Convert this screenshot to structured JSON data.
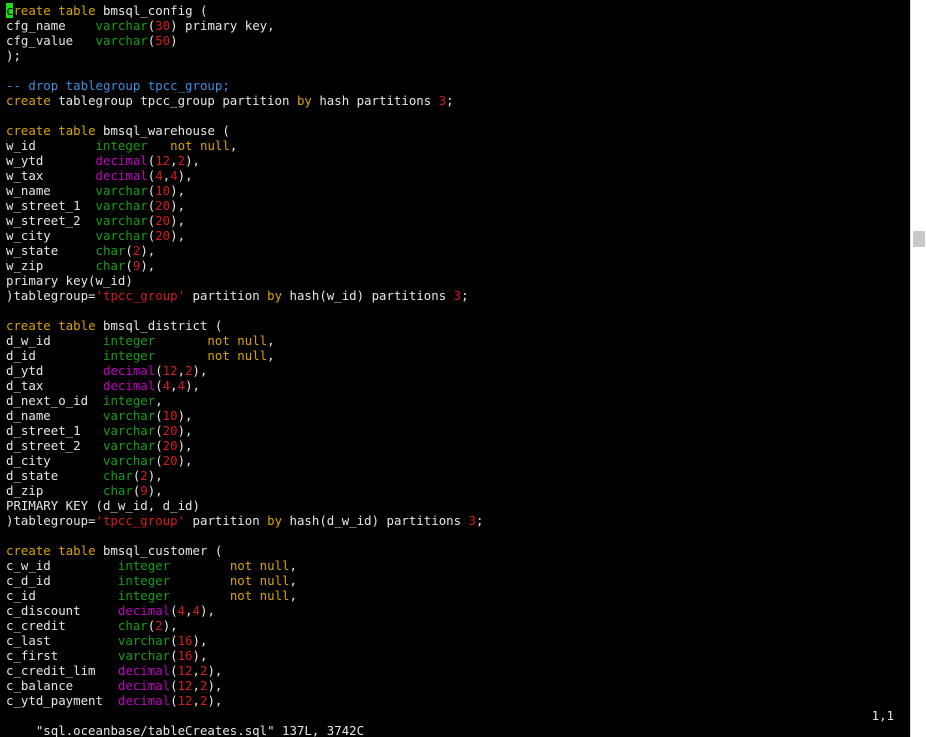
{
  "app": {
    "name": "vim",
    "colors": {
      "background": "#000000",
      "text": "#e6e6e6",
      "keyword": "#d9a300",
      "type": "#159e15",
      "number": "#d61b1b",
      "function": "#c000c0",
      "comment": "#3a8fe0",
      "cursor": "#15e015"
    }
  },
  "editor": {
    "lines": [
      [
        [
          "kw",
          "create"
        ],
        [
          "t",
          " "
        ],
        [
          "kw",
          "table"
        ],
        [
          "t",
          " bmsql_config ("
        ]
      ],
      [
        [
          "t",
          "cfg_name    "
        ],
        [
          "type",
          "varchar"
        ],
        [
          "t",
          "("
        ],
        [
          "num",
          "30"
        ],
        [
          "t",
          ") primary key,"
        ]
      ],
      [
        [
          "t",
          "cfg_value   "
        ],
        [
          "type",
          "varchar"
        ],
        [
          "t",
          "("
        ],
        [
          "num",
          "50"
        ],
        [
          "t",
          ")"
        ]
      ],
      [
        [
          "t",
          ");"
        ]
      ],
      [],
      [
        [
          "comment",
          "-- drop tablegroup tpcc_group;"
        ]
      ],
      [
        [
          "kw",
          "create"
        ],
        [
          "t",
          " tablegroup tpcc_group partition "
        ],
        [
          "kw",
          "by"
        ],
        [
          "t",
          " hash partitions "
        ],
        [
          "num",
          "3"
        ],
        [
          "t",
          ";"
        ]
      ],
      [],
      [
        [
          "kw",
          "create"
        ],
        [
          "t",
          " "
        ],
        [
          "kw",
          "table"
        ],
        [
          "t",
          " bmsql_warehouse ("
        ]
      ],
      [
        [
          "t",
          "w_id        "
        ],
        [
          "type",
          "integer"
        ],
        [
          "t",
          "   "
        ],
        [
          "null",
          "not"
        ],
        [
          "t",
          " "
        ],
        [
          "null",
          "null"
        ],
        [
          "t",
          ","
        ]
      ],
      [
        [
          "t",
          "w_ytd       "
        ],
        [
          "fn",
          "decimal"
        ],
        [
          "t",
          "("
        ],
        [
          "num",
          "12"
        ],
        [
          "t",
          ","
        ],
        [
          "num",
          "2"
        ],
        [
          "t",
          "),"
        ]
      ],
      [
        [
          "t",
          "w_tax       "
        ],
        [
          "fn",
          "decimal"
        ],
        [
          "t",
          "("
        ],
        [
          "num",
          "4"
        ],
        [
          "t",
          ","
        ],
        [
          "num",
          "4"
        ],
        [
          "t",
          "),"
        ]
      ],
      [
        [
          "t",
          "w_name      "
        ],
        [
          "type",
          "varchar"
        ],
        [
          "t",
          "("
        ],
        [
          "num",
          "10"
        ],
        [
          "t",
          "),"
        ]
      ],
      [
        [
          "t",
          "w_street_1  "
        ],
        [
          "type",
          "varchar"
        ],
        [
          "t",
          "("
        ],
        [
          "num",
          "20"
        ],
        [
          "t",
          "),"
        ]
      ],
      [
        [
          "t",
          "w_street_2  "
        ],
        [
          "type",
          "varchar"
        ],
        [
          "t",
          "("
        ],
        [
          "num",
          "20"
        ],
        [
          "t",
          "),"
        ]
      ],
      [
        [
          "t",
          "w_city      "
        ],
        [
          "type",
          "varchar"
        ],
        [
          "t",
          "("
        ],
        [
          "num",
          "20"
        ],
        [
          "t",
          "),"
        ]
      ],
      [
        [
          "t",
          "w_state     "
        ],
        [
          "type",
          "char"
        ],
        [
          "t",
          "("
        ],
        [
          "num",
          "2"
        ],
        [
          "t",
          "),"
        ]
      ],
      [
        [
          "t",
          "w_zip       "
        ],
        [
          "type",
          "char"
        ],
        [
          "t",
          "("
        ],
        [
          "num",
          "9"
        ],
        [
          "t",
          "),"
        ]
      ],
      [
        [
          "t",
          "primary key(w_id)"
        ]
      ],
      [
        [
          "t",
          ")tablegroup="
        ],
        [
          "str",
          "'tpcc_group'"
        ],
        [
          "t",
          " partition "
        ],
        [
          "kw",
          "by"
        ],
        [
          "t",
          " hash(w_id) partitions "
        ],
        [
          "num",
          "3"
        ],
        [
          "t",
          ";"
        ]
      ],
      [],
      [
        [
          "kw",
          "create"
        ],
        [
          "t",
          " "
        ],
        [
          "kw",
          "table"
        ],
        [
          "t",
          " bmsql_district ("
        ]
      ],
      [
        [
          "t",
          "d_w_id       "
        ],
        [
          "type",
          "integer"
        ],
        [
          "t",
          "       "
        ],
        [
          "null",
          "not"
        ],
        [
          "t",
          " "
        ],
        [
          "null",
          "null"
        ],
        [
          "t",
          ","
        ]
      ],
      [
        [
          "t",
          "d_id         "
        ],
        [
          "type",
          "integer"
        ],
        [
          "t",
          "       "
        ],
        [
          "null",
          "not"
        ],
        [
          "t",
          " "
        ],
        [
          "null",
          "null"
        ],
        [
          "t",
          ","
        ]
      ],
      [
        [
          "t",
          "d_ytd        "
        ],
        [
          "fn",
          "decimal"
        ],
        [
          "t",
          "("
        ],
        [
          "num",
          "12"
        ],
        [
          "t",
          ","
        ],
        [
          "num",
          "2"
        ],
        [
          "t",
          "),"
        ]
      ],
      [
        [
          "t",
          "d_tax        "
        ],
        [
          "fn",
          "decimal"
        ],
        [
          "t",
          "("
        ],
        [
          "num",
          "4"
        ],
        [
          "t",
          ","
        ],
        [
          "num",
          "4"
        ],
        [
          "t",
          "),"
        ]
      ],
      [
        [
          "t",
          "d_next_o_id  "
        ],
        [
          "type",
          "integer"
        ],
        [
          "t",
          ","
        ]
      ],
      [
        [
          "t",
          "d_name       "
        ],
        [
          "type",
          "varchar"
        ],
        [
          "t",
          "("
        ],
        [
          "num",
          "10"
        ],
        [
          "t",
          "),"
        ]
      ],
      [
        [
          "t",
          "d_street_1   "
        ],
        [
          "type",
          "varchar"
        ],
        [
          "t",
          "("
        ],
        [
          "num",
          "20"
        ],
        [
          "t",
          "),"
        ]
      ],
      [
        [
          "t",
          "d_street_2   "
        ],
        [
          "type",
          "varchar"
        ],
        [
          "t",
          "("
        ],
        [
          "num",
          "20"
        ],
        [
          "t",
          "),"
        ]
      ],
      [
        [
          "t",
          "d_city       "
        ],
        [
          "type",
          "varchar"
        ],
        [
          "t",
          "("
        ],
        [
          "num",
          "20"
        ],
        [
          "t",
          "),"
        ]
      ],
      [
        [
          "t",
          "d_state      "
        ],
        [
          "type",
          "char"
        ],
        [
          "t",
          "("
        ],
        [
          "num",
          "2"
        ],
        [
          "t",
          "),"
        ]
      ],
      [
        [
          "t",
          "d_zip        "
        ],
        [
          "type",
          "char"
        ],
        [
          "t",
          "("
        ],
        [
          "num",
          "9"
        ],
        [
          "t",
          "),"
        ]
      ],
      [
        [
          "t",
          "PRIMARY KEY (d_w_id, d_id)"
        ]
      ],
      [
        [
          "t",
          ")tablegroup="
        ],
        [
          "str",
          "'tpcc_group'"
        ],
        [
          "t",
          " partition "
        ],
        [
          "kw",
          "by"
        ],
        [
          "t",
          " hash(d_w_id) partitions "
        ],
        [
          "num",
          "3"
        ],
        [
          "t",
          ";"
        ]
      ],
      [],
      [
        [
          "kw",
          "create"
        ],
        [
          "t",
          " "
        ],
        [
          "kw",
          "table"
        ],
        [
          "t",
          " bmsql_customer ("
        ]
      ],
      [
        [
          "t",
          "c_w_id         "
        ],
        [
          "type",
          "integer"
        ],
        [
          "t",
          "        "
        ],
        [
          "null",
          "not"
        ],
        [
          "t",
          " "
        ],
        [
          "null",
          "null"
        ],
        [
          "t",
          ","
        ]
      ],
      [
        [
          "t",
          "c_d_id         "
        ],
        [
          "type",
          "integer"
        ],
        [
          "t",
          "        "
        ],
        [
          "null",
          "not"
        ],
        [
          "t",
          " "
        ],
        [
          "null",
          "null"
        ],
        [
          "t",
          ","
        ]
      ],
      [
        [
          "t",
          "c_id           "
        ],
        [
          "type",
          "integer"
        ],
        [
          "t",
          "        "
        ],
        [
          "null",
          "not"
        ],
        [
          "t",
          " "
        ],
        [
          "null",
          "null"
        ],
        [
          "t",
          ","
        ]
      ],
      [
        [
          "t",
          "c_discount     "
        ],
        [
          "fn",
          "decimal"
        ],
        [
          "t",
          "("
        ],
        [
          "num",
          "4"
        ],
        [
          "t",
          ","
        ],
        [
          "num",
          "4"
        ],
        [
          "t",
          "),"
        ]
      ],
      [
        [
          "t",
          "c_credit       "
        ],
        [
          "type",
          "char"
        ],
        [
          "t",
          "("
        ],
        [
          "num",
          "2"
        ],
        [
          "t",
          "),"
        ]
      ],
      [
        [
          "t",
          "c_last         "
        ],
        [
          "type",
          "varchar"
        ],
        [
          "t",
          "("
        ],
        [
          "num",
          "16"
        ],
        [
          "t",
          "),"
        ]
      ],
      [
        [
          "t",
          "c_first        "
        ],
        [
          "type",
          "varchar"
        ],
        [
          "t",
          "("
        ],
        [
          "num",
          "16"
        ],
        [
          "t",
          "),"
        ]
      ],
      [
        [
          "t",
          "c_credit_lim   "
        ],
        [
          "fn",
          "decimal"
        ],
        [
          "t",
          "("
        ],
        [
          "num",
          "12"
        ],
        [
          "t",
          ","
        ],
        [
          "num",
          "2"
        ],
        [
          "t",
          "),"
        ]
      ],
      [
        [
          "t",
          "c_balance      "
        ],
        [
          "fn",
          "decimal"
        ],
        [
          "t",
          "("
        ],
        [
          "num",
          "12"
        ],
        [
          "t",
          ","
        ],
        [
          "num",
          "2"
        ],
        [
          "t",
          "),"
        ]
      ],
      [
        [
          "t",
          "c_ytd_payment  "
        ],
        [
          "fn",
          "decimal"
        ],
        [
          "t",
          "("
        ],
        [
          "num",
          "12"
        ],
        [
          "t",
          ","
        ],
        [
          "num",
          "2"
        ],
        [
          "t",
          "),"
        ]
      ]
    ]
  },
  "statusbar": {
    "file_info": "\"sql.oceanbase/tableCreates.sql\" 137L, 3742C",
    "cursor_position": "1,1"
  },
  "scrollbar": {
    "position_fraction": 0.32
  }
}
